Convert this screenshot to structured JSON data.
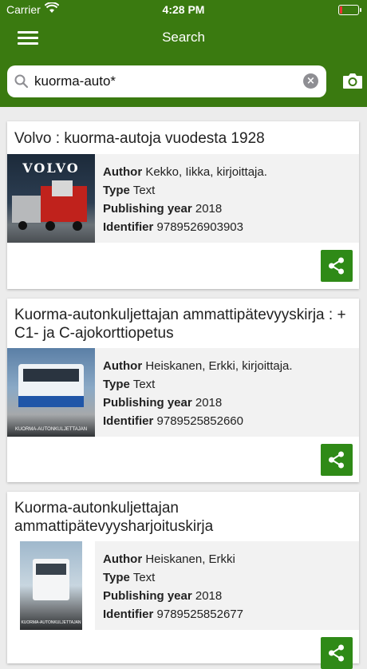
{
  "status": {
    "carrier": "Carrier",
    "time": "4:28 PM"
  },
  "header": {
    "title": "Search"
  },
  "search": {
    "query": "kuorma-auto*"
  },
  "labels": {
    "author": "Author",
    "type": "Type",
    "year": "Publishing year",
    "identifier": "Identifier"
  },
  "results": [
    {
      "title": "Volvo : kuorma-autoja vuodesta 1928",
      "author": "Kekko, Iikka, kirjoittaja.",
      "type": "Text",
      "year": "2018",
      "identifier": "9789526903903",
      "cover_text": "VOLVO"
    },
    {
      "title": "Kuorma-autonkuljettajan ammattipätevyyskirja : + C1- ja C-ajokorttiopetus",
      "author": "Heiskanen, Erkki, kirjoittaja.",
      "type": "Text",
      "year": "2018",
      "identifier": "9789525852660",
      "cover_text": "KUORMA-AUTONKULJETTAJAN"
    },
    {
      "title": "Kuorma-autonkuljettajan ammattipätevyysharjoituskirja",
      "author": "Heiskanen, Erkki",
      "type": "Text",
      "year": "2018",
      "identifier": "9789525852677",
      "cover_text": "KUORMA-AUTONKULJETTAJAN"
    }
  ],
  "colors": {
    "header": "#3a7a10",
    "share_button": "#2f8a17"
  }
}
